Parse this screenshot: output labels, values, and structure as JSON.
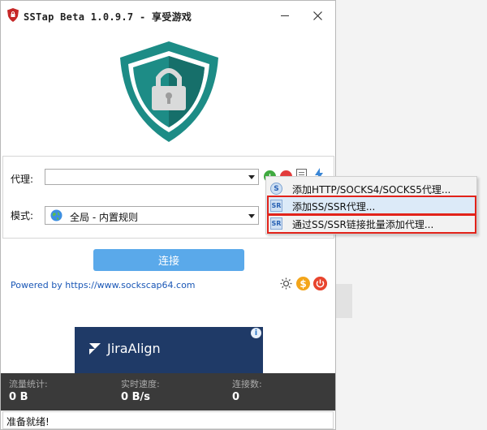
{
  "window": {
    "title": "SSTap Beta 1.0.9.7 - 享受游戏",
    "minimize_icon": "minimize-icon",
    "close_icon": "close-icon"
  },
  "form": {
    "proxy_label": "代理:",
    "proxy_value": "",
    "mode_label": "模式:",
    "mode_value": "全局 - 内置规则"
  },
  "proxy_menu": {
    "items": [
      {
        "icon": "S",
        "label": "添加HTTP/SOCKS4/SOCKS5代理..."
      },
      {
        "icon": "SR",
        "label": "添加SS/SSR代理..."
      },
      {
        "icon": "SR",
        "label": "通过SS/SSR链接批量添加代理..."
      }
    ]
  },
  "connect_label": "连接",
  "powered_by": "Powered by https://www.sockscap64.com",
  "ad": {
    "brand": "JiraAlign",
    "info": "i"
  },
  "stats": {
    "traffic_label": "流量统计:",
    "traffic_value": "0 B",
    "speed_label": "实时速度:",
    "speed_value": "0 B/s",
    "connections_label": "连接数:",
    "connections_value": "0"
  },
  "status": "准备就绪!",
  "colors": {
    "accent": "#5aa9ea",
    "shield": "#1d8c86",
    "highlight": "#e2231a",
    "stats_bg": "#3a3a3a"
  }
}
